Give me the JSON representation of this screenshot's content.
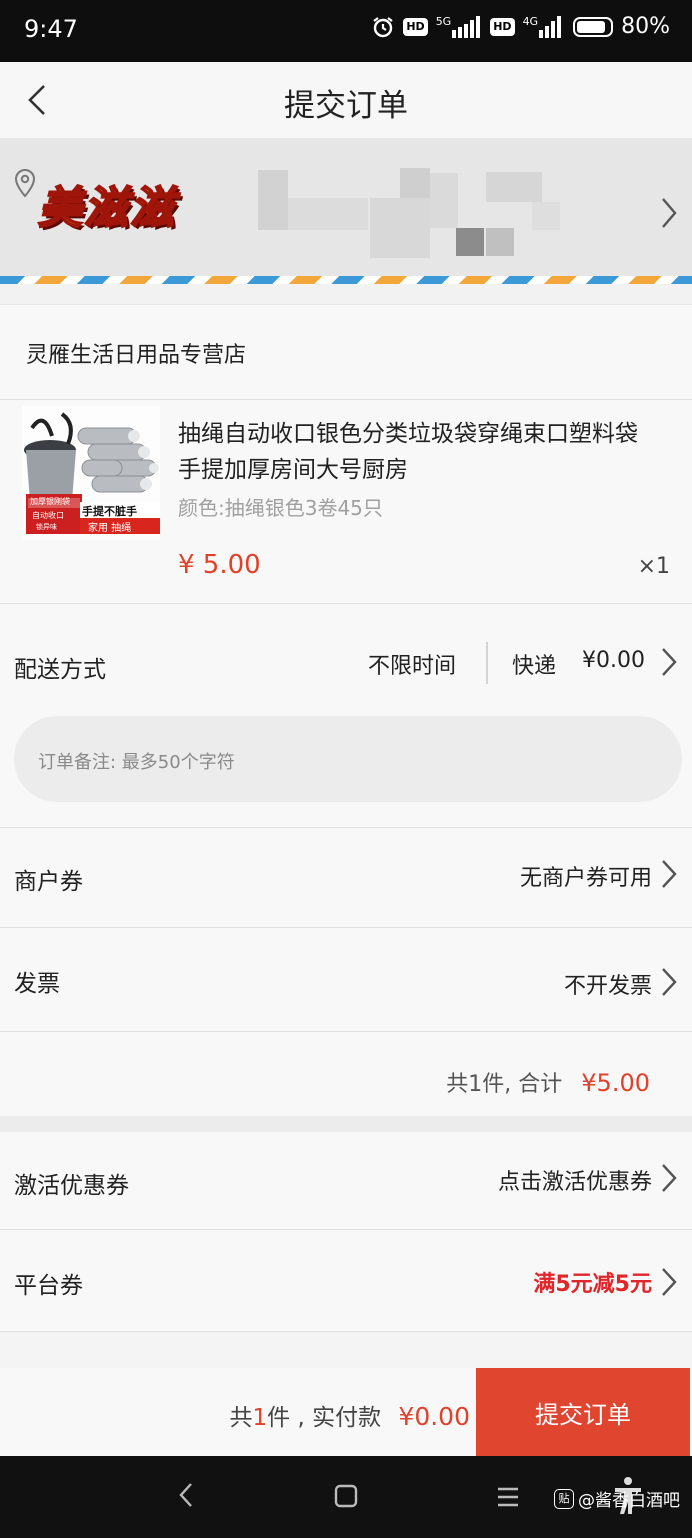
{
  "status_bar": {
    "time": "9:47",
    "net1": "5G",
    "net2": "4G",
    "hd1": "HD",
    "hd2": "HD",
    "battery": "80%"
  },
  "header": {
    "title": "提交订单"
  },
  "address": {
    "logo_text": "美滋滋"
  },
  "store": {
    "name": "灵雁生活日用品专营店"
  },
  "product": {
    "title": "抽绳自动收口银色分类垃圾袋穿绳束口塑料袋手提加厚房间大号厨房",
    "spec": "颜色:抽绳银色3卷45只",
    "price": "¥ 5.00",
    "qty": "×1",
    "img_badge1": "加厚银刚袋",
    "img_badge2": "自动收口",
    "img_badge3": "锁异味",
    "img_caption1": "手提不脏手",
    "img_caption2": "家用 抽绳"
  },
  "delivery": {
    "label": "配送方式",
    "time": "不限时间",
    "method": "快递",
    "fee": "¥0.00",
    "remark_placeholder": "订单备注: 最多50个字符"
  },
  "merchant_coupon": {
    "label": "商户券",
    "value": "无商户券可用"
  },
  "invoice": {
    "label": "发票",
    "value": "不开发票"
  },
  "subtotal": {
    "count_text": "共1件,  合计",
    "amount": "¥5.00"
  },
  "activate_coupon": {
    "label": "激活优惠券",
    "value": "点击激活优惠券"
  },
  "platform_coupon": {
    "label": "平台券",
    "value": "满5元减5元"
  },
  "bottom": {
    "prefix": "共",
    "count": "1",
    "suffix": "件 , 实付款",
    "amount": "¥0.00",
    "submit_label": "提交订单"
  },
  "watermark": {
    "badge": "贴",
    "text": "@酱香白酒吧"
  },
  "colors": {
    "accent_red": "#e0412a",
    "submit_bg": "#e04530"
  }
}
